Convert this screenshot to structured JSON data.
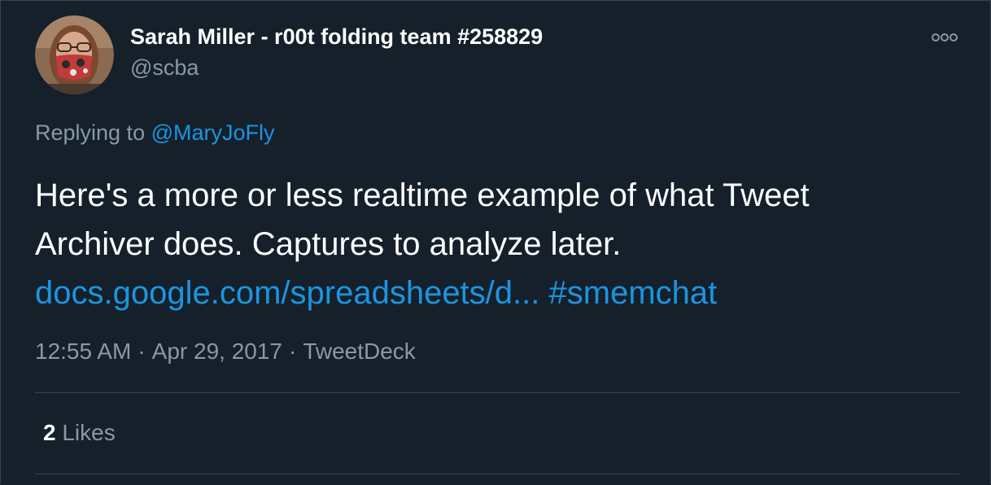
{
  "tweet": {
    "author": {
      "display_name": "Sarah Miller - r00t folding team #258829",
      "handle": "@scba",
      "avatar_icon": "profile-photo"
    },
    "more_icon": "more-horizontal-icon",
    "replying_to_prefix": "Replying to",
    "replying_to_handle": "@MaryJoFly",
    "text_line_1": "Here's a more or less realtime example of what Tweet",
    "text_line_2": "Archiver does. Captures to analyze later.",
    "link": "docs.google.com/spreadsheets/d...",
    "hashtag": "#smemchat",
    "time": "12:55 AM",
    "date": "Apr 29, 2017",
    "separator": "·",
    "source": "TweetDeck",
    "likes_count": "2",
    "likes_label": "Likes"
  },
  "colors": {
    "background": "#15202b",
    "border": "#38444d",
    "secondary_text": "#8899a6",
    "link": "#1b95e0",
    "primary_text": "#ffffff"
  }
}
